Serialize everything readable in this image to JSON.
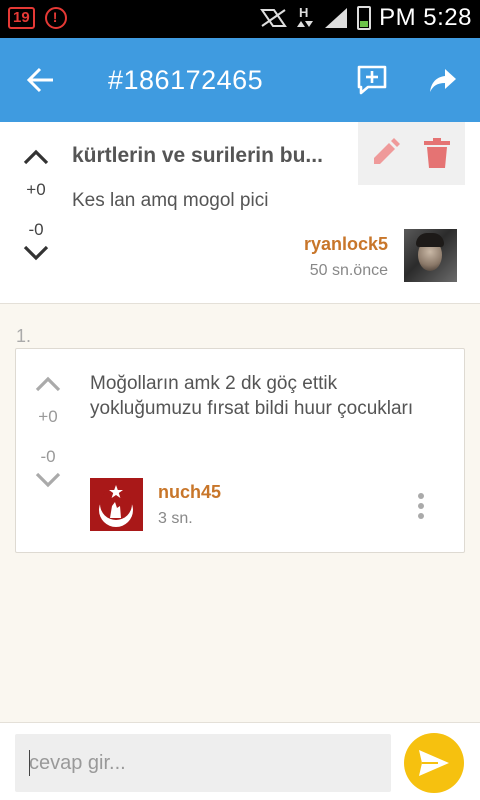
{
  "status_bar": {
    "notification_count": "19",
    "time": "PM 5:28"
  },
  "app_bar": {
    "title": "#186172465"
  },
  "post": {
    "title": "kürtlerin ve surilerin bu...",
    "body": "Kes lan amq mogol pici",
    "upvotes": "+0",
    "downvotes": "-0",
    "author": "ryanlock5",
    "time": "50 sn.önce"
  },
  "comments": [
    {
      "index": "1.",
      "text": "Moğolların amk 2 dk göç ettik yokluğumuzu fırsat bildi huur çocukları",
      "upvotes": "+0",
      "downvotes": "-0",
      "author": "nuch45",
      "time": "3 sn."
    }
  ],
  "reply": {
    "placeholder": "cevap gir..."
  },
  "colors": {
    "app_bar": "#3f9be0",
    "author_name": "#c8762a",
    "edit_icon": "#ef9a9a",
    "delete_icon": "#e57373",
    "send_button": "#f6c10f"
  }
}
